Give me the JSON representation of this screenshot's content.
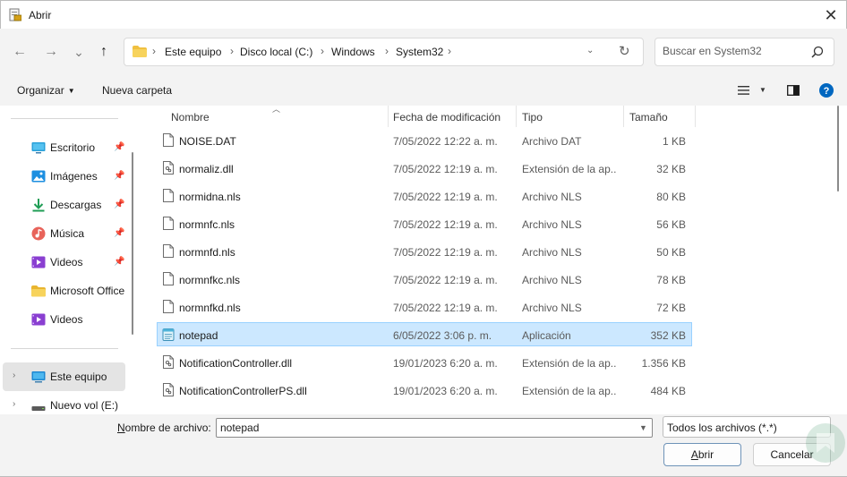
{
  "window": {
    "title": "Abrir",
    "close_glyph": "✕"
  },
  "nav": {
    "back_glyph": "←",
    "forward_glyph": "→",
    "recent_glyph": "⌄",
    "up_glyph": "↑",
    "breadcrumbs": [
      "Este equipo",
      "Disco local (C:)",
      "Windows",
      "System32"
    ],
    "separator": "›",
    "search_placeholder": "Buscar en System32"
  },
  "toolbar": {
    "organize_label": "Organizar",
    "new_folder_label": "Nueva carpeta"
  },
  "sidebar": {
    "quick_access": [
      {
        "label": "Escritorio",
        "icon": "desktop-icon",
        "pinned": true
      },
      {
        "label": "Imágenes",
        "icon": "pictures-icon",
        "pinned": true
      },
      {
        "label": "Descargas",
        "icon": "download-icon",
        "pinned": true
      },
      {
        "label": "Música",
        "icon": "music-icon",
        "pinned": true
      },
      {
        "label": "Videos",
        "icon": "videos-icon",
        "pinned": true
      },
      {
        "label": "Microsoft Office",
        "icon": "folder-icon",
        "pinned": false
      },
      {
        "label": "Videos",
        "icon": "videos-icon",
        "pinned": false
      }
    ],
    "this_pc_label": "Este equipo",
    "drive_label": "Nuevo vol (E:)"
  },
  "columns": {
    "name": "Nombre",
    "date": "Fecha de modificación",
    "type": "Tipo",
    "size": "Tamaño"
  },
  "files": [
    {
      "name": "NOISE.DAT",
      "date": "7/05/2022 12:22 a. m.",
      "type": "Archivo DAT",
      "size": "1 KB",
      "icon": "file-icon"
    },
    {
      "name": "normaliz.dll",
      "date": "7/05/2022 12:19 a. m.",
      "type": "Extensión de la ap...",
      "size": "32 KB",
      "icon": "dll-file-icon"
    },
    {
      "name": "normidna.nls",
      "date": "7/05/2022 12:19 a. m.",
      "type": "Archivo NLS",
      "size": "80 KB",
      "icon": "file-icon"
    },
    {
      "name": "normnfc.nls",
      "date": "7/05/2022 12:19 a. m.",
      "type": "Archivo NLS",
      "size": "56 KB",
      "icon": "file-icon"
    },
    {
      "name": "normnfd.nls",
      "date": "7/05/2022 12:19 a. m.",
      "type": "Archivo NLS",
      "size": "50 KB",
      "icon": "file-icon"
    },
    {
      "name": "normnfkc.nls",
      "date": "7/05/2022 12:19 a. m.",
      "type": "Archivo NLS",
      "size": "78 KB",
      "icon": "file-icon"
    },
    {
      "name": "normnfkd.nls",
      "date": "7/05/2022 12:19 a. m.",
      "type": "Archivo NLS",
      "size": "72 KB",
      "icon": "file-icon"
    },
    {
      "name": "notepad",
      "date": "6/05/2022 3:06 p. m.",
      "type": "Aplicación",
      "size": "352 KB",
      "icon": "notepad-app-icon",
      "selected": true
    },
    {
      "name": "NotificationController.dll",
      "date": "19/01/2023 6:20 a. m.",
      "type": "Extensión de la ap...",
      "size": "1.356 KB",
      "icon": "dll-file-icon"
    },
    {
      "name": "NotificationControllerPS.dll",
      "date": "19/01/2023 6:20 a. m.",
      "type": "Extensión de la ap...",
      "size": "484 KB",
      "icon": "dll-file-icon"
    }
  ],
  "bottom": {
    "filename_label": "Nombre de archivo:",
    "filename_value": "notepad",
    "filter_value": "Todos los archivos (*.*)",
    "open_label": "Abrir",
    "cancel_label": "Cancelar"
  },
  "colors": {
    "accent": "#0067c0",
    "selection_bg": "#cce8ff",
    "selection_border": "#99d1ff",
    "chrome_bg": "#f3f3f3"
  }
}
